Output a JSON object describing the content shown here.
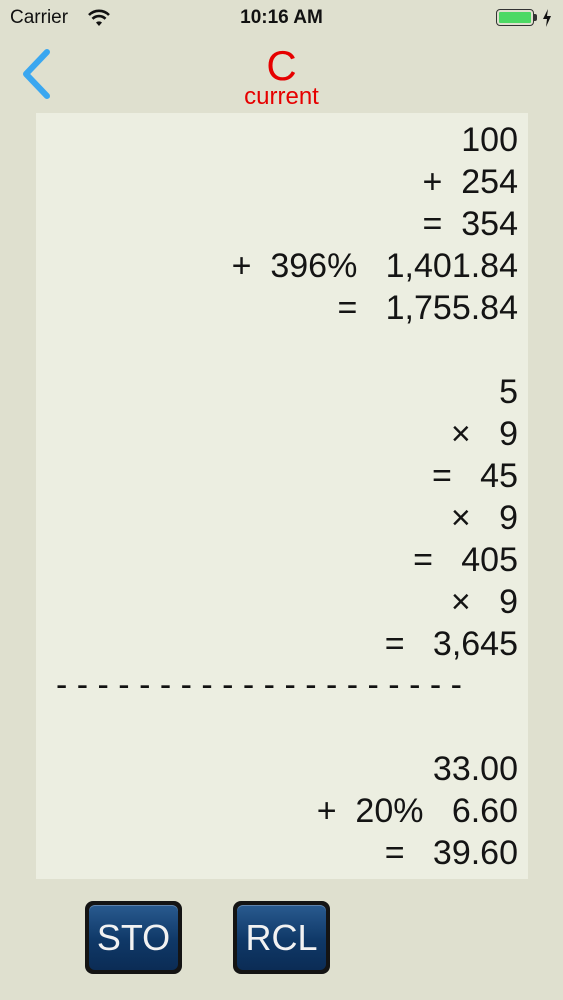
{
  "status_bar": {
    "carrier": "Carrier",
    "time": "10:16 AM",
    "battery_color": "#4cd964"
  },
  "nav": {
    "back_icon": "chevron-left-icon",
    "title": "C",
    "subtitle": "current",
    "title_color": "#e60000",
    "back_color": "#3aa7f0"
  },
  "tape": {
    "lines": [
      "100",
      "+  254",
      "=  354",
      "+  396%   1,401.84",
      "=   1,755.84",
      "5",
      "×   9",
      "=   45",
      "×   9",
      "=   405",
      "×   9",
      "=   3,645",
      "33.00",
      "+  20%   6.60",
      "=   39.60"
    ],
    "divider": "- - - - - - - - - - - - - - - - - - - -"
  },
  "buttons": {
    "sto_label": "STO",
    "rcl_label": "RCL"
  }
}
